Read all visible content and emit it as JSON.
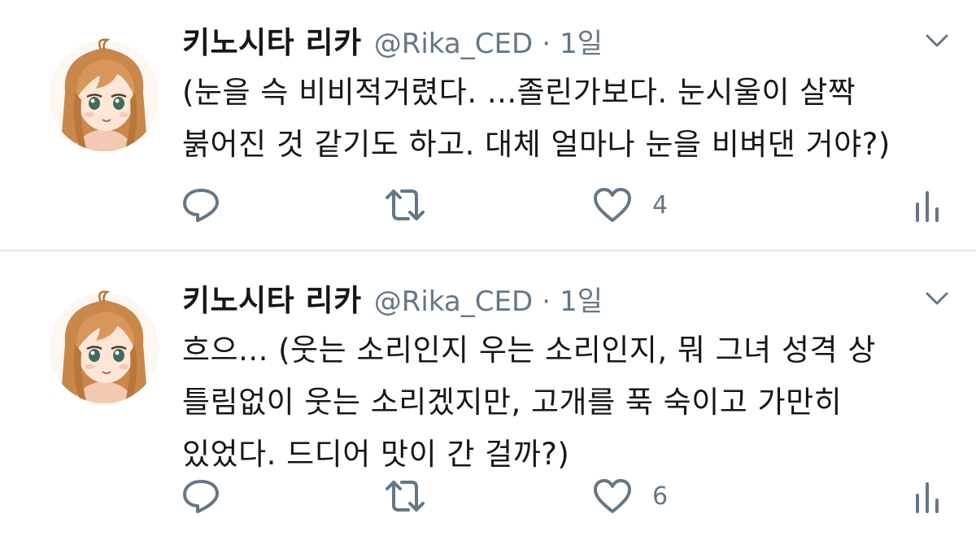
{
  "tweets": [
    {
      "author": {
        "name": "키노시타 리카",
        "handle": "@Rika_CED"
      },
      "separator": "·",
      "time": "1일",
      "lines": [
        "(눈을 슥 비비적거렸다. ...졸린가보다. 눈시울이 살짝",
        "붉어진 것 같기도 하고. 대체 얼마나 눈을 비벼댄 거야?)"
      ],
      "likes": "4"
    },
    {
      "author": {
        "name": "키노시타 리카",
        "handle": "@Rika_CED"
      },
      "separator": "·",
      "time": "1일",
      "lines": [
        "흐으... (웃는 소리인지 우는 소리인지, 뭐 그녀 성격 상",
        "틀림없이 웃는 소리겠지만, 고개를 푹 숙이고 가만히",
        "있었다. 드디어 맛이 간 걸까?)"
      ],
      "likes": "6"
    }
  ],
  "icons": {
    "reply": "reply-icon",
    "retweet": "retweet-icon",
    "like": "heart-icon",
    "stats": "analytics-icon",
    "more": "chevron-down-icon"
  },
  "colors": {
    "text": "#14171a",
    "secondary": "#657786",
    "icon": "#657786",
    "divider": "#e1e8ed"
  }
}
